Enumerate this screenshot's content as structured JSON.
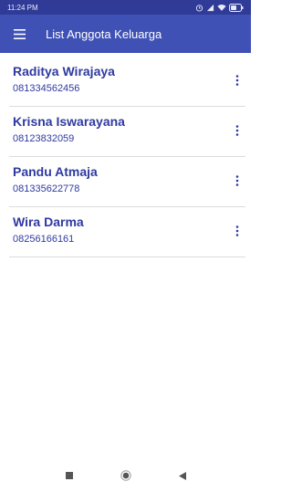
{
  "status_bar": {
    "time": "11:24 PM",
    "icons": [
      "alarm-icon",
      "signal-icon",
      "wifi-icon",
      "battery-icon"
    ]
  },
  "app_bar": {
    "title": "List Anggota Keluarga",
    "menu_icon": "hamburger-menu-icon"
  },
  "members": [
    {
      "name": "Raditya Wirajaya",
      "phone": "081334562456"
    },
    {
      "name": "Krisna Iswarayana",
      "phone": "08123832059"
    },
    {
      "name": "Pandu Atmaja",
      "phone": "081335622778"
    },
    {
      "name": "Wira Darma",
      "phone": "08256166161"
    }
  ],
  "item_action_icon": "more-vertical-icon",
  "nav_bar": {
    "icons": [
      "recents-square-icon",
      "home-circle-icon",
      "back-triangle-icon"
    ]
  },
  "colors": {
    "accent": "#3f51b5",
    "status_bar": "#2f3b97",
    "text": "#2f3aa0"
  }
}
